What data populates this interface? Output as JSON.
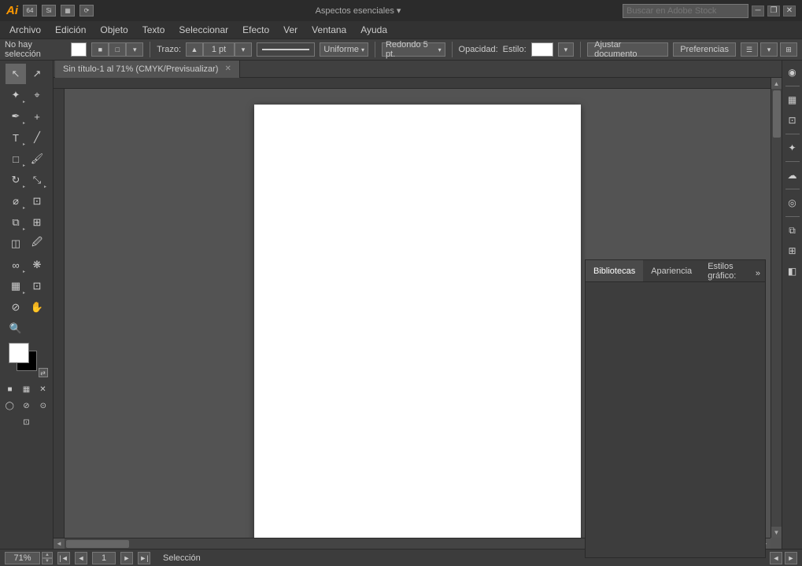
{
  "app": {
    "logo": "Ai",
    "workspace": "Aspectos esenciales",
    "search_placeholder": "Buscar en Adobe Stock"
  },
  "title_bar": {
    "btn1": "64",
    "btn2": "Si",
    "btn3": "▦",
    "btn4": "⟳",
    "win_minimize": "─",
    "win_restore": "❐",
    "win_close": "✕"
  },
  "menu": {
    "items": [
      "Archivo",
      "Edición",
      "Objeto",
      "Texto",
      "Seleccionar",
      "Efecto",
      "Ver",
      "Ventana",
      "Ayuda"
    ]
  },
  "toolbar": {
    "selection": "No hay selección",
    "trazo_label": "Trazo:",
    "trazo_value": "1 pt",
    "stroke_type": "Uniforme",
    "corner": "Redondo 5 pt.",
    "opacity_label": "Opacidad:",
    "style_label": "Estilo:",
    "adjust_doc": "Ajustar documento",
    "preferences": "Preferencias"
  },
  "tab": {
    "title": "Sin título-1 al 71% (CMYK/Previsualizar)",
    "close": "✕"
  },
  "panels": {
    "bibliotecas": "Bibliotecas",
    "apariencia": "Apariencia",
    "estilos_graficos": "Estilos gráfico:",
    "more": "»"
  },
  "bottom": {
    "zoom": "71%",
    "page": "1",
    "status": "Selección"
  },
  "tools": [
    {
      "id": "select",
      "icon": "↖",
      "has_arrow": true
    },
    {
      "id": "direct-select",
      "icon": "↗",
      "has_arrow": false
    },
    {
      "id": "magic-wand",
      "icon": "✦",
      "has_arrow": true
    },
    {
      "id": "lasso",
      "icon": "⌖",
      "has_arrow": false
    },
    {
      "id": "pen",
      "icon": "✒",
      "has_arrow": true
    },
    {
      "id": "add-anchor",
      "icon": "+",
      "has_arrow": false
    },
    {
      "id": "type",
      "icon": "T",
      "has_arrow": true
    },
    {
      "id": "line",
      "icon": "╱",
      "has_arrow": true
    },
    {
      "id": "rect",
      "icon": "□",
      "has_arrow": true
    },
    {
      "id": "rotate",
      "icon": "↻",
      "has_arrow": true
    },
    {
      "id": "scale",
      "icon": "⤡",
      "has_arrow": true
    },
    {
      "id": "warp",
      "icon": "⌀",
      "has_arrow": true
    },
    {
      "id": "graph",
      "icon": "▣",
      "has_arrow": true
    },
    {
      "id": "mesh",
      "icon": "⊞",
      "has_arrow": false
    },
    {
      "id": "gradient",
      "icon": "◫",
      "has_arrow": false
    },
    {
      "id": "eyedropper",
      "icon": "🖉",
      "has_arrow": true
    },
    {
      "id": "blend",
      "icon": "∞",
      "has_arrow": true
    },
    {
      "id": "symbol",
      "icon": "❋",
      "has_arrow": true
    },
    {
      "id": "column-graph",
      "icon": "▦",
      "has_arrow": true
    },
    {
      "id": "artboard",
      "icon": "⊡",
      "has_arrow": true
    },
    {
      "id": "slice",
      "icon": "⊘",
      "has_arrow": true
    },
    {
      "id": "hand",
      "icon": "✋",
      "has_arrow": false
    },
    {
      "id": "zoom",
      "icon": "🔍",
      "has_arrow": false
    }
  ],
  "far_right_icons": [
    "◉",
    "▦",
    "⊡",
    "✦",
    "☁",
    "◎",
    "⧉",
    "⊞",
    "◧"
  ]
}
